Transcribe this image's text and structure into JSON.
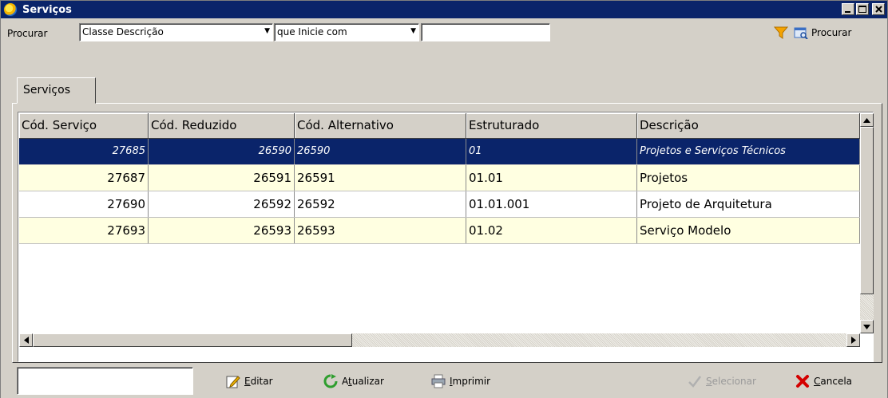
{
  "window": {
    "title": "Serviços"
  },
  "search": {
    "label": "Procurar",
    "field": "Classe Descrição",
    "condition": "que Inicie com",
    "value": "",
    "button": "Procurar"
  },
  "tabs": [
    {
      "label": "Serviços",
      "active": true
    }
  ],
  "table": {
    "columns": [
      "Cód. Serviço",
      "Cód. Reduzido",
      "Cód. Alternativo",
      "Estruturado",
      "Descrição"
    ],
    "rows": [
      {
        "cod_servico": "27685",
        "cod_reduzido": "26590",
        "cod_alternativo": "26590",
        "estruturado": "01",
        "descricao": "Projetos e Serviços Técnicos",
        "selected": true
      },
      {
        "cod_servico": "27687",
        "cod_reduzido": "26591",
        "cod_alternativo": "26591",
        "estruturado": "01.01",
        "descricao": "Projetos"
      },
      {
        "cod_servico": "27690",
        "cod_reduzido": "26592",
        "cod_alternativo": "26592",
        "estruturado": "01.01.001",
        "descricao": "Projeto de Arquitetura"
      },
      {
        "cod_servico": "27693",
        "cod_reduzido": "26593",
        "cod_alternativo": "26593",
        "estruturado": "01.02",
        "descricao": "Serviço Modelo"
      }
    ]
  },
  "toolbar": {
    "quick_input": "",
    "edit_label_u": "E",
    "edit_label_rest": "ditar",
    "refresh_label_pre": "A",
    "refresh_label_u": "t",
    "refresh_label_rest": "ualizar",
    "print_label_u": "I",
    "print_label_rest": "mprimir",
    "select_label_u": "S",
    "select_label_rest": "elecionar",
    "cancel_label_u": "C",
    "cancel_label_rest": "ancela"
  },
  "colors": {
    "titlebar": "#0a246a",
    "selected_row": "#0a246a",
    "alt_row": "#ffffe1",
    "window_bg": "#d4d0c8",
    "filter_icon": "#f5a300",
    "cancel_icon": "#d40000",
    "refresh_icon": "#2e9e2e"
  }
}
